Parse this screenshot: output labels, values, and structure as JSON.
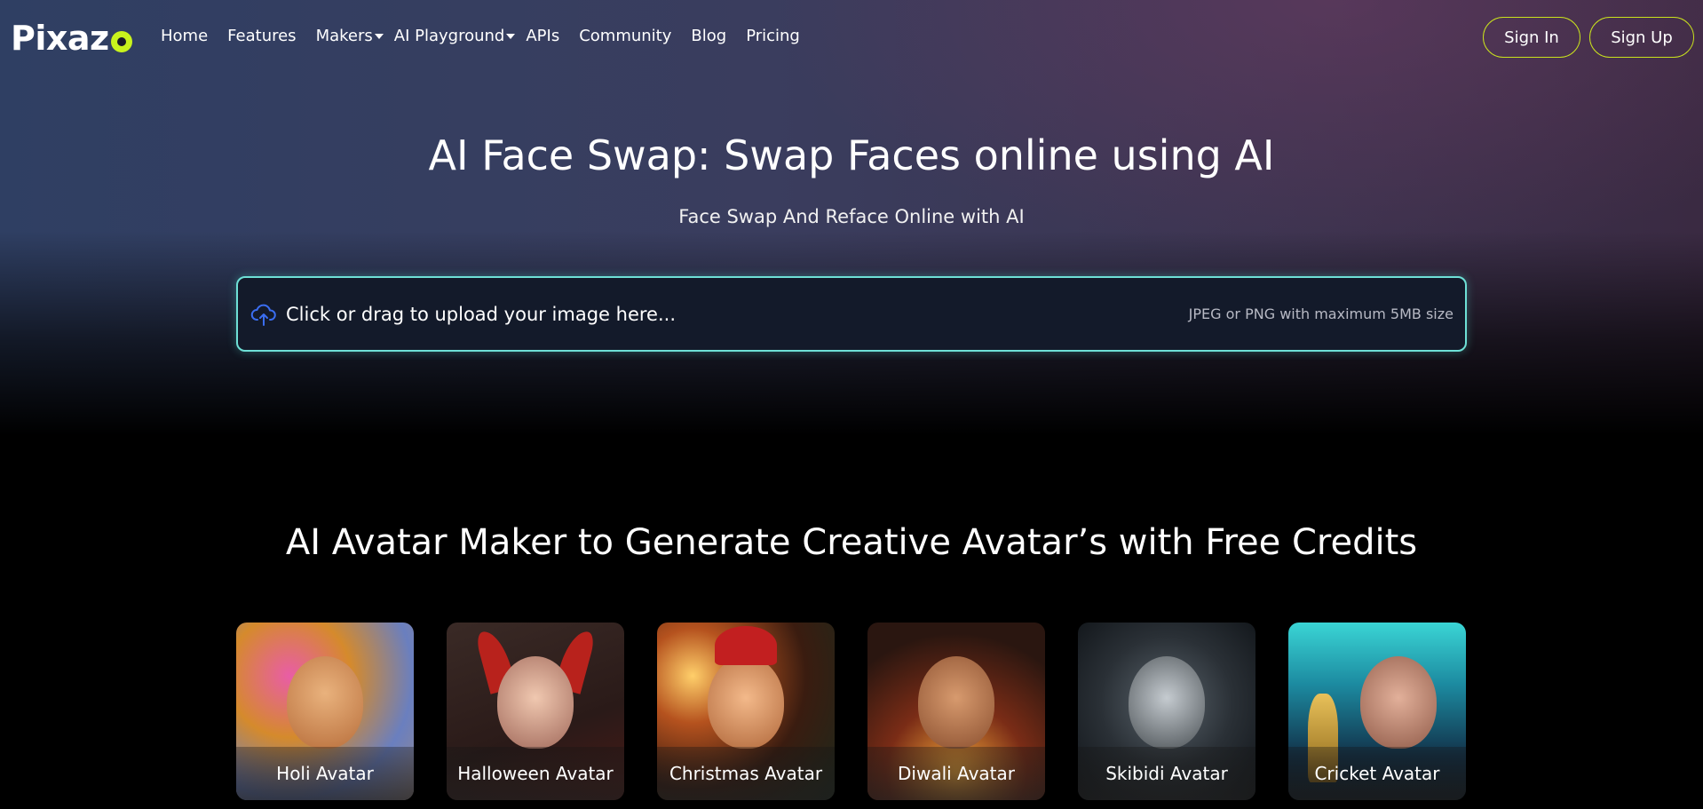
{
  "nav": {
    "logo_text": "Pixaz",
    "links": [
      {
        "label": "Home"
      },
      {
        "label": "Features"
      },
      {
        "label": "Makers"
      },
      {
        "label": "AI Playground"
      },
      {
        "label": "APIs"
      },
      {
        "label": "Community"
      },
      {
        "label": "Blog"
      },
      {
        "label": "Pricing"
      }
    ],
    "sign_in": "Sign In",
    "sign_up": "Sign Up"
  },
  "hero": {
    "title": "AI Face Swap: Swap Faces online using AI",
    "subtitle": "Face Swap And Reface Online with AI"
  },
  "upload": {
    "prompt": "Click or drag to upload your image here...",
    "hint": "JPEG or PNG with maximum 5MB size"
  },
  "avatars": {
    "title": "AI Avatar Maker to Generate Creative Avatar’s with Free Credits",
    "items": [
      {
        "label": "Holi Avatar"
      },
      {
        "label": "Halloween Avatar"
      },
      {
        "label": "Christmas Avatar"
      },
      {
        "label": "Diwali Avatar"
      },
      {
        "label": "Skibidi Avatar"
      },
      {
        "label": "Cricket Avatar"
      }
    ]
  },
  "colors": {
    "accent_lime": "#c9e21d",
    "upload_border": "#6ee0d6",
    "upload_icon": "#3a6df0"
  },
  "icons": {
    "upload": "cloud-upload-icon",
    "dropdown": "caret-down-icon"
  }
}
